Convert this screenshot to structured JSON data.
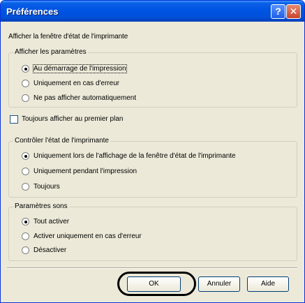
{
  "window": {
    "title": "Préférences",
    "help_glyph": "?",
    "close_glyph": "✕"
  },
  "main": {
    "heading": "Afficher la fenêtre d'état de l'imprimante",
    "display_params": {
      "legend": "Afficher les paramètres",
      "options": [
        {
          "label": "Au démarrage de l'impression",
          "selected": true
        },
        {
          "label": "Uniquement en cas d'erreur",
          "selected": false
        },
        {
          "label": "Ne pas afficher automatiquement",
          "selected": false
        }
      ]
    },
    "always_on_top": {
      "label": "Toujours afficher au premier plan",
      "checked": false
    },
    "control_status": {
      "legend": "Contrôler l'état de l'imprimante",
      "options": [
        {
          "label": "Uniquement lors de l'affichage de la fenêtre d'état de l'imprimante",
          "selected": true
        },
        {
          "label": "Uniquement pendant l'impression",
          "selected": false
        },
        {
          "label": "Toujours",
          "selected": false
        }
      ]
    },
    "sound_params": {
      "legend": "Paramètres sons",
      "options": [
        {
          "label": "Tout activer",
          "selected": true
        },
        {
          "label": "Activer uniquement en cas d'erreur",
          "selected": false
        },
        {
          "label": "Désactiver",
          "selected": false
        }
      ]
    }
  },
  "buttons": {
    "ok": "OK",
    "cancel": "Annuler",
    "help": "Aide"
  },
  "colors": {
    "title_bar": "#0054e3",
    "dialog_bg": "#ece9d8",
    "highlight": "#000000"
  }
}
